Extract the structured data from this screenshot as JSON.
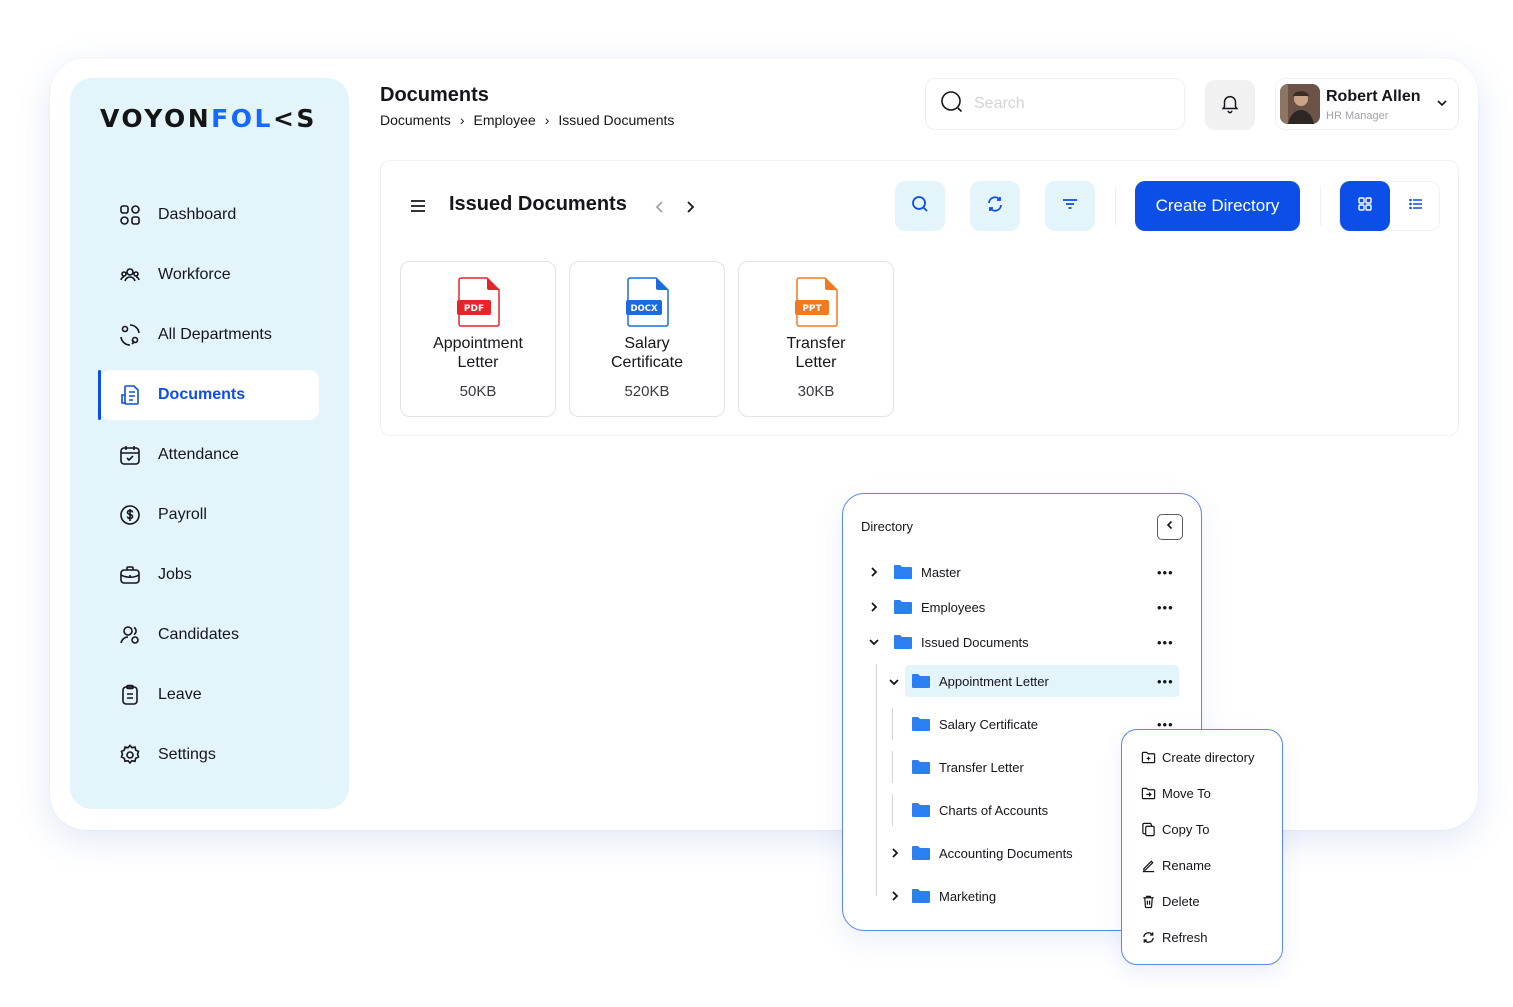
{
  "brand": {
    "logo_a": "VOYON",
    "logo_b": "FOL",
    "logo_c": "<S",
    "accent_color": "#1569ff"
  },
  "sidebar": {
    "items": [
      {
        "label": "Dashboard",
        "icon": "dashboard-grid-icon"
      },
      {
        "label": "Workforce",
        "icon": "workforce-icon"
      },
      {
        "label": "All Departments",
        "icon": "departments-icon"
      },
      {
        "label": "Documents",
        "icon": "documents-icon",
        "active": true
      },
      {
        "label": "Attendance",
        "icon": "calendar-check-icon"
      },
      {
        "label": "Payroll",
        "icon": "dollar-circle-icon"
      },
      {
        "label": "Jobs",
        "icon": "briefcase-icon"
      },
      {
        "label": "Candidates",
        "icon": "candidates-icon"
      },
      {
        "label": "Leave",
        "icon": "clipboard-icon"
      },
      {
        "label": "Settings",
        "icon": "gear-icon"
      }
    ]
  },
  "header": {
    "title": "Documents",
    "breadcrumb": [
      "Documents",
      "Employee",
      "Issued Documents"
    ],
    "search_placeholder": "Search",
    "user": {
      "name": "Robert Allen",
      "role": "HR Manager"
    }
  },
  "panel": {
    "title": "Issued Documents",
    "create_label": "Create Directory",
    "primary_color": "#0c4ee8",
    "files": [
      {
        "name_line1": "Appointment",
        "name_line2": "Letter",
        "size": "50KB",
        "type": "PDF",
        "color": "#e5252a"
      },
      {
        "name_line1": "Salary",
        "name_line2": "Certificate",
        "size": "520KB",
        "type": "DOCX",
        "color": "#1b6ae0"
      },
      {
        "name_line1": "Transfer",
        "name_line2": "Letter",
        "size": "30KB",
        "type": "PPT",
        "color": "#f07a21"
      }
    ]
  },
  "directory": {
    "title": "Directory",
    "rows": [
      {
        "label": "Master"
      },
      {
        "label": "Employees"
      },
      {
        "label": "Issued Documents"
      },
      {
        "label": "Appointment Letter"
      },
      {
        "label": "Salary Certificate"
      },
      {
        "label": "Transfer Letter"
      },
      {
        "label": "Charts of Accounts"
      },
      {
        "label": "Accounting Documents"
      },
      {
        "label": "Marketing"
      }
    ],
    "more_symbol": "•••"
  },
  "context_menu": {
    "items": [
      "Create directory",
      "Move To",
      "Copy To",
      "Rename",
      "Delete",
      "Refresh"
    ]
  }
}
